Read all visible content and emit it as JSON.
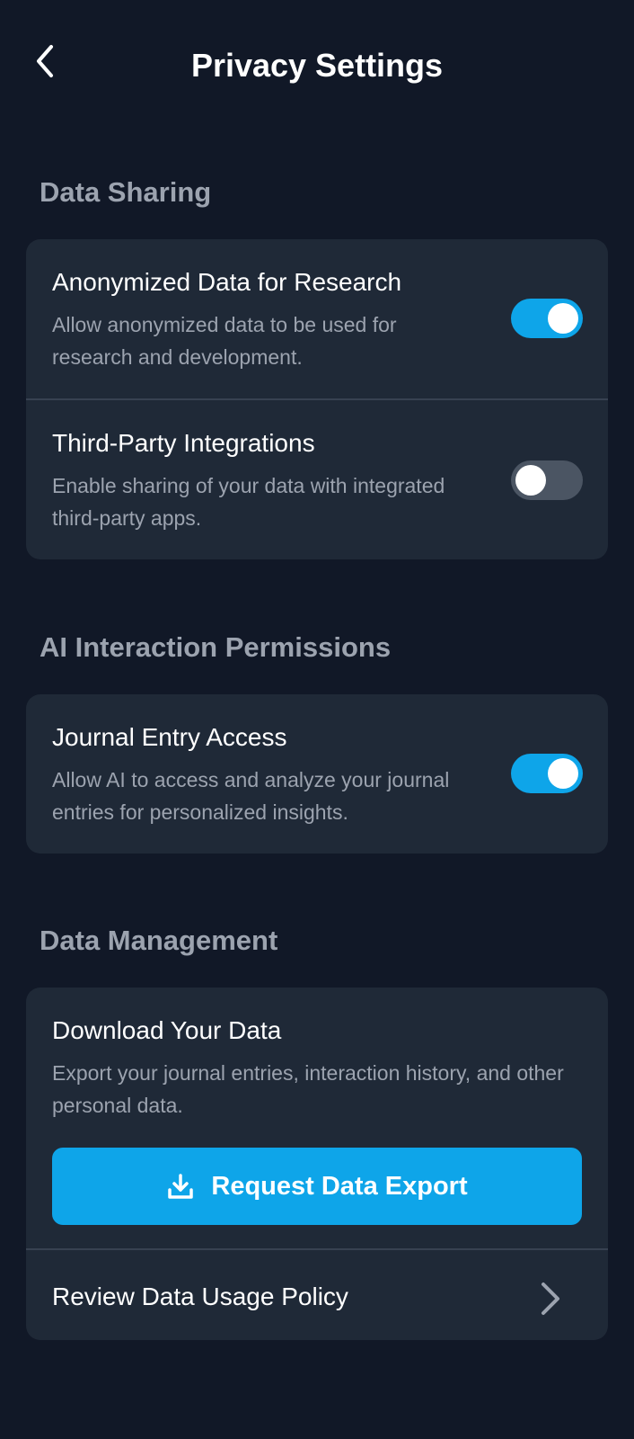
{
  "header": {
    "title": "Privacy Settings",
    "back_icon": "chevron-left-icon"
  },
  "sections": {
    "data_sharing": {
      "title": "Data Sharing",
      "items": [
        {
          "title": "Anonymized Data for Research",
          "description": "Allow anonymized data to be used for research and development.",
          "enabled": true
        },
        {
          "title": "Third-Party Integrations",
          "description": "Enable sharing of your data with integrated third-party apps.",
          "enabled": false
        }
      ]
    },
    "ai_permissions": {
      "title": "AI Interaction Permissions",
      "items": [
        {
          "title": "Journal Entry Access",
          "description": "Allow AI to access and analyze your journal entries for personalized insights.",
          "enabled": true
        }
      ]
    },
    "data_management": {
      "title": "Data Management",
      "download": {
        "title": "Download Your Data",
        "description": "Export your journal entries, interaction history, and other personal data.",
        "button_label": "Request Data Export",
        "button_icon": "download-icon"
      },
      "policy_link": {
        "label": "Review Data Usage Policy",
        "icon": "chevron-right-icon"
      }
    }
  },
  "colors": {
    "background": "#111827",
    "card": "#1f2937",
    "accent": "#0ea5e9",
    "toggle_off": "#4b5563",
    "muted_text": "#9ca3af"
  }
}
